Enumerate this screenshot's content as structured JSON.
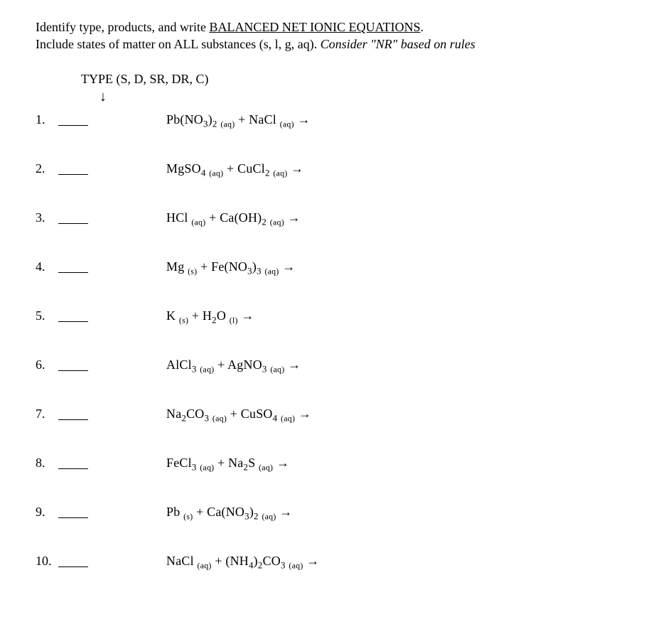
{
  "instructions": {
    "line1_prefix": "Identify type, products, and write ",
    "line1_underline": "BALANCED NET IONIC EQUATIONS",
    "line1_suffix": ".",
    "line2_prefix": "Include states of matter on ALL substances (s, l, g, aq).  ",
    "line2_italic": "Consider \"NR\" based on rules"
  },
  "typeHeader": "TYPE (S, D, SR, DR, C)",
  "arrowDown": "↓",
  "arrowRight": "→",
  "problems": [
    {
      "num": "1.",
      "r1": {
        "f": "Pb(NO",
        "s1": "3",
        "m": ")",
        "s2": "2",
        "st": "(aq)"
      },
      "plus": "  +  ",
      "r2": {
        "f": "NaCl",
        "st": "(aq)"
      }
    },
    {
      "num": "2.",
      "r1": {
        "f": "MgSO",
        "s1": "4",
        "st": "(aq)"
      },
      "plus": "  +  ",
      "r2": {
        "f": "CuCl",
        "s1": "2",
        "st": "(aq)"
      }
    },
    {
      "num": "3.",
      "r1": {
        "f": "HCl",
        "st": "(aq)"
      },
      "plus": "  +  ",
      "r2": {
        "f": "Ca(OH)",
        "s1": "2",
        "st": "(aq)"
      }
    },
    {
      "num": "4.",
      "r1": {
        "f": "Mg",
        "st": "(s)"
      },
      "plus": "   +  ",
      "r2": {
        "f": "Fe(NO",
        "s1": "3",
        "m": ")",
        "s2": "3",
        "st": "(aq)"
      }
    },
    {
      "num": "5.",
      "r1": {
        "f": "K",
        "st": "(s)"
      },
      "plus": "  +  ",
      "r2": {
        "f": "H",
        "s1": "2",
        "m": "O",
        "st": "(l)"
      }
    },
    {
      "num": "6.",
      "r1": {
        "f": "AlCl",
        "s1": "3",
        "st": "(aq)"
      },
      "plus": "  +  ",
      "r2": {
        "f": "AgNO",
        "s1": "3",
        "st": "(aq)"
      }
    },
    {
      "num": "7.",
      "r1": {
        "f": "Na",
        "s1": "2",
        "m": "CO",
        "s2": "3",
        "st": "(aq)"
      },
      "plus": "  +  ",
      "r2": {
        "f": "CuSO",
        "s1": "4",
        "st": "(aq)"
      }
    },
    {
      "num": "8.",
      "r1": {
        "f": "FeCl",
        "s1": "3",
        "st": "(aq)"
      },
      "plus": "  +  ",
      "r2": {
        "f": "Na",
        "s1": "2",
        "m": "S",
        "st": "(aq)"
      }
    },
    {
      "num": "9.",
      "r1": {
        "f": "Pb",
        "st": "(s)"
      },
      "plus": "    +    ",
      "r2": {
        "f": "Ca(NO",
        "s1": "3",
        "m": ")",
        "s2": "2",
        "st": "(aq)"
      }
    },
    {
      "num": "10.",
      "r1": {
        "f": "NaCl",
        "st": "(aq)"
      },
      "plus": "  +  ",
      "r2": {
        "f": "(NH",
        "s1": "4",
        "m": ")",
        "s2": "2",
        "m2": "CO",
        "s3": "3",
        "st": "(aq)"
      }
    }
  ]
}
